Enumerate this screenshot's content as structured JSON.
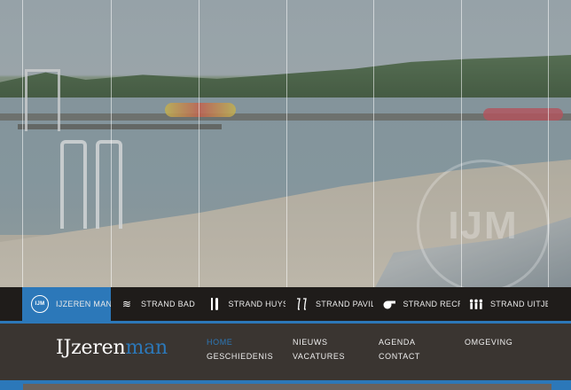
{
  "hero": {
    "watermark": "IJM"
  },
  "topnav": {
    "items": [
      {
        "label": "",
        "icon": "blank"
      },
      {
        "label": "IJZEREN MAN",
        "icon": "ijm-logo-icon",
        "icon_text": "IJM",
        "active": true
      },
      {
        "label": "STRAND BAD",
        "icon": "waves-icon"
      },
      {
        "label": "STRAND HUYS",
        "icon": "cutlery-icon"
      },
      {
        "label": "STRAND PAVILJOEN",
        "icon": "glasses-icon"
      },
      {
        "label": "STRAND RECREATIE",
        "icon": "whistle-icon"
      },
      {
        "label": "STRAND UITJES",
        "icon": "group-icon"
      }
    ]
  },
  "logo": {
    "part1": "IJzeren",
    "part2": "man"
  },
  "submenu": {
    "items": [
      {
        "label": "HOME",
        "current": true
      },
      {
        "label": "NIEUWS"
      },
      {
        "label": "AGENDA"
      },
      {
        "label": "OMGEVING"
      },
      {
        "label": "GESCHIEDENIS"
      },
      {
        "label": "VACATURES"
      },
      {
        "label": "CONTACT"
      }
    ]
  },
  "colors": {
    "accent": "#2c78b9",
    "nav_bg": "#1f1c1a",
    "footer_bg": "#3a3531"
  }
}
